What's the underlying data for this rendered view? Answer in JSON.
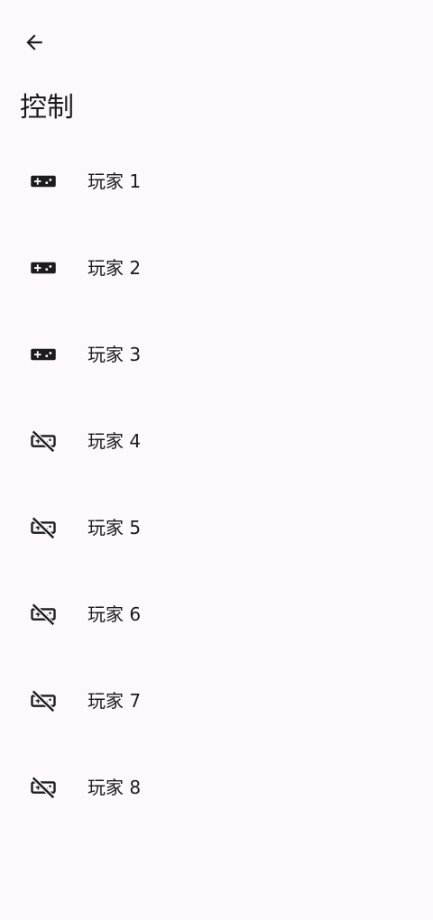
{
  "header": {
    "back_icon": "arrow-back-icon",
    "title": "控制"
  },
  "players": [
    {
      "label": "玩家 1",
      "icon": "gamepad-icon",
      "connected": true
    },
    {
      "label": "玩家 2",
      "icon": "gamepad-icon",
      "connected": true
    },
    {
      "label": "玩家 3",
      "icon": "gamepad-icon",
      "connected": true
    },
    {
      "label": "玩家 4",
      "icon": "gamepad-off-icon",
      "connected": false
    },
    {
      "label": "玩家 5",
      "icon": "gamepad-off-icon",
      "connected": false
    },
    {
      "label": "玩家 6",
      "icon": "gamepad-off-icon",
      "connected": false
    },
    {
      "label": "玩家 7",
      "icon": "gamepad-off-icon",
      "connected": false
    },
    {
      "label": "玩家 8",
      "icon": "gamepad-off-icon",
      "connected": false
    }
  ]
}
